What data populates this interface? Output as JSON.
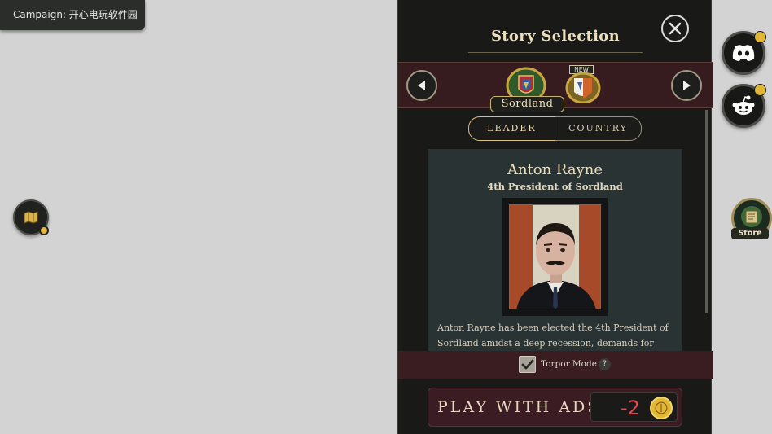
{
  "campaign": {
    "label": "Campaign: 开心电玩软件园"
  },
  "panel": {
    "title": "Story Selection",
    "country_name": "Sordland",
    "new_tag": "NEW",
    "tabs": [
      {
        "label": "LEADER",
        "active": true
      },
      {
        "label": "COUNTRY",
        "active": false
      }
    ]
  },
  "leader": {
    "name": "Anton Rayne",
    "title": "4th President of Sordland",
    "bio_line_1": "Anton Rayne has been elected the 4th President of",
    "bio_line_2": "Sordland amidst a deep recession, demands for"
  },
  "torpor": {
    "label": "Torpor Mode",
    "checked": true,
    "help_glyph": "?"
  },
  "play": {
    "label": "PLAY WITH ADS",
    "cost": "-2"
  },
  "store": {
    "label": "Store"
  },
  "icons": {
    "map": "map-icon",
    "close": "close-icon",
    "left": "arrow-left-icon",
    "right": "arrow-right-icon",
    "discord": "discord-icon",
    "reddit": "reddit-icon",
    "store": "store-icon",
    "coin": "coin-icon"
  },
  "colors": {
    "accent_gold": "#e3b736",
    "panel_bg": "#191917",
    "band_bg": "#361b1f",
    "cost_red": "#e8484c"
  }
}
